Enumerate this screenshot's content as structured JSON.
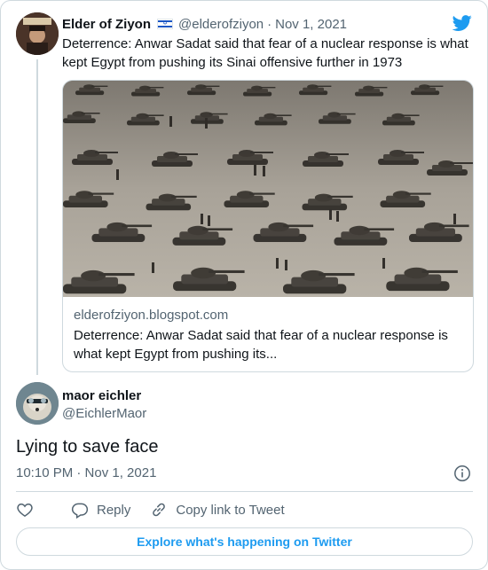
{
  "colors": {
    "accent": "#1d9bf0",
    "secondary_text": "#536471",
    "primary_text": "#0f1419",
    "border": "#cfd9de",
    "flag_blue": "#1a56c4"
  },
  "quoted_tweet": {
    "author_name": "Elder of Ziyon",
    "flag_icon": "israel-flag-icon",
    "handle": "@elderofziyon",
    "separator": "·",
    "date": "Nov 1, 2021",
    "text": "Deterrence: Anwar Sadat said that fear of a nuclear response is what kept Egypt from pushing its Sinai offensive further in 1973",
    "link_card": {
      "domain": "elderofziyon.blogspot.com",
      "title": "Deterrence: Anwar Sadat said that fear of a nuclear response is what kept Egypt from pushing its..."
    }
  },
  "tweet": {
    "author_name": "maor eichler",
    "handle": "@EichlerMaor",
    "text": "Lying to save face",
    "timestamp": "10:10 PM · Nov 1, 2021"
  },
  "actions": {
    "like_icon": "heart-icon",
    "reply_label": "Reply",
    "copy_link_label": "Copy link to Tweet"
  },
  "explore_label": "Explore what's happening on Twitter",
  "brand_icon": "twitter-bird-icon"
}
